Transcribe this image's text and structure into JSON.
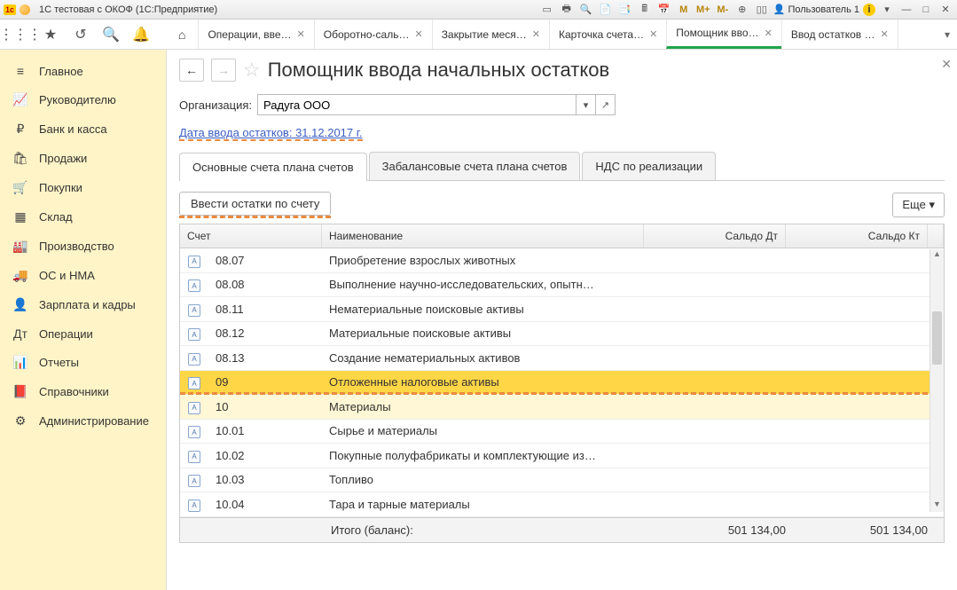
{
  "titlebar": {
    "title": "1С тестовая с ОКОФ  (1С:Предприятие)",
    "user": "Пользователь 1",
    "labels": {
      "m": "M",
      "mp": "M+",
      "mm": "M-"
    }
  },
  "appbar": {
    "tabs": [
      {
        "label": "Операции, вве…",
        "closable": true
      },
      {
        "label": "Оборотно-саль…",
        "closable": true
      },
      {
        "label": "Закрытие меся…",
        "closable": true
      },
      {
        "label": "Карточка счета…",
        "closable": true
      },
      {
        "label": "Помощник вво…",
        "closable": true,
        "active": true
      },
      {
        "label": "Ввод остатков …",
        "closable": true
      }
    ]
  },
  "sidebar": {
    "items": [
      {
        "icon": "≡",
        "label": "Главное"
      },
      {
        "icon": "📈",
        "label": "Руководителю"
      },
      {
        "icon": "₽",
        "label": "Банк и касса"
      },
      {
        "icon": "🛍",
        "label": "Продажи"
      },
      {
        "icon": "🛒",
        "label": "Покупки"
      },
      {
        "icon": "▦",
        "label": "Склад"
      },
      {
        "icon": "🏭",
        "label": "Производство"
      },
      {
        "icon": "🚚",
        "label": "ОС и НМА"
      },
      {
        "icon": "👤",
        "label": "Зарплата и кадры"
      },
      {
        "icon": "Дт",
        "label": "Операции"
      },
      {
        "icon": "📊",
        "label": "Отчеты"
      },
      {
        "icon": "📕",
        "label": "Справочники"
      },
      {
        "icon": "⚙",
        "label": "Администрирование"
      }
    ]
  },
  "page": {
    "title": "Помощник ввода начальных остатков",
    "org_label": "Организация:",
    "org_value": "Радуга ООО",
    "balance_date_link": "Дата ввода остатков: 31.12.2017 г.",
    "tabs": [
      {
        "label": "Основные счета плана счетов",
        "active": true
      },
      {
        "label": "Забалансовые счета плана счетов"
      },
      {
        "label": "НДС по реализации"
      }
    ],
    "enter_btn": "Ввести остатки по счету",
    "more_btn": "Еще",
    "columns": {
      "acct": "Счет",
      "name": "Наименование",
      "dt": "Сальдо Дт",
      "kt": "Сальдо Кт"
    },
    "rows": [
      {
        "code": "08.07",
        "name": "Приобретение взрослых животных"
      },
      {
        "code": "08.08",
        "name": "Выполнение научно-исследовательских, опытн…"
      },
      {
        "code": "08.11",
        "name": "Нематериальные поисковые активы"
      },
      {
        "code": "08.12",
        "name": "Материальные поисковые активы"
      },
      {
        "code": "08.13",
        "name": "Создание нематериальных активов"
      },
      {
        "code": "09",
        "name": "Отложенные налоговые активы",
        "selected": true
      },
      {
        "code": "10",
        "name": "Материалы",
        "next_highlight": true
      },
      {
        "code": "10.01",
        "name": "Сырье и материалы"
      },
      {
        "code": "10.02",
        "name": "Покупные полуфабрикаты и комплектующие из…"
      },
      {
        "code": "10.03",
        "name": "Топливо"
      },
      {
        "code": "10.04",
        "name": "Тара и тарные материалы"
      }
    ],
    "footer": {
      "label": "Итого (баланс):",
      "dt": "501 134,00",
      "kt": "501 134,00"
    }
  }
}
